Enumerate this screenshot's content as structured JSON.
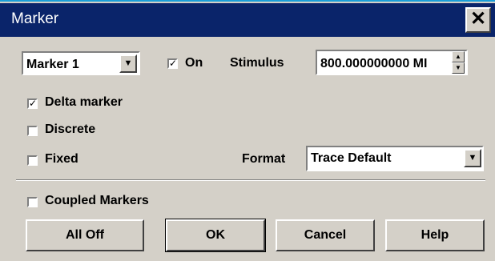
{
  "window": {
    "title": "Marker",
    "close_glyph": "✕"
  },
  "marker_select": {
    "value": "Marker 1"
  },
  "on_checkbox": {
    "label": "On",
    "checked": true
  },
  "stimulus": {
    "label": "Stimulus",
    "value": "800.000000000 MI"
  },
  "delta_marker": {
    "label": "Delta marker",
    "checked": true
  },
  "discrete": {
    "label": "Discrete",
    "checked": false
  },
  "fixed": {
    "label": "Fixed",
    "checked": false
  },
  "format": {
    "label": "Format",
    "value": "Trace Default"
  },
  "coupled_markers": {
    "label": "Coupled Markers",
    "checked": false
  },
  "buttons": {
    "all_off": "All Off",
    "ok": "OK",
    "cancel": "Cancel",
    "help": "Help"
  },
  "glyphs": {
    "check": "✓",
    "arrow_down": "▼",
    "arrow_up": "▲"
  },
  "colors": {
    "titlebar": "#0a246a",
    "dialog_bg": "#d4d0c8",
    "accent_top": "#1a9fd8"
  }
}
